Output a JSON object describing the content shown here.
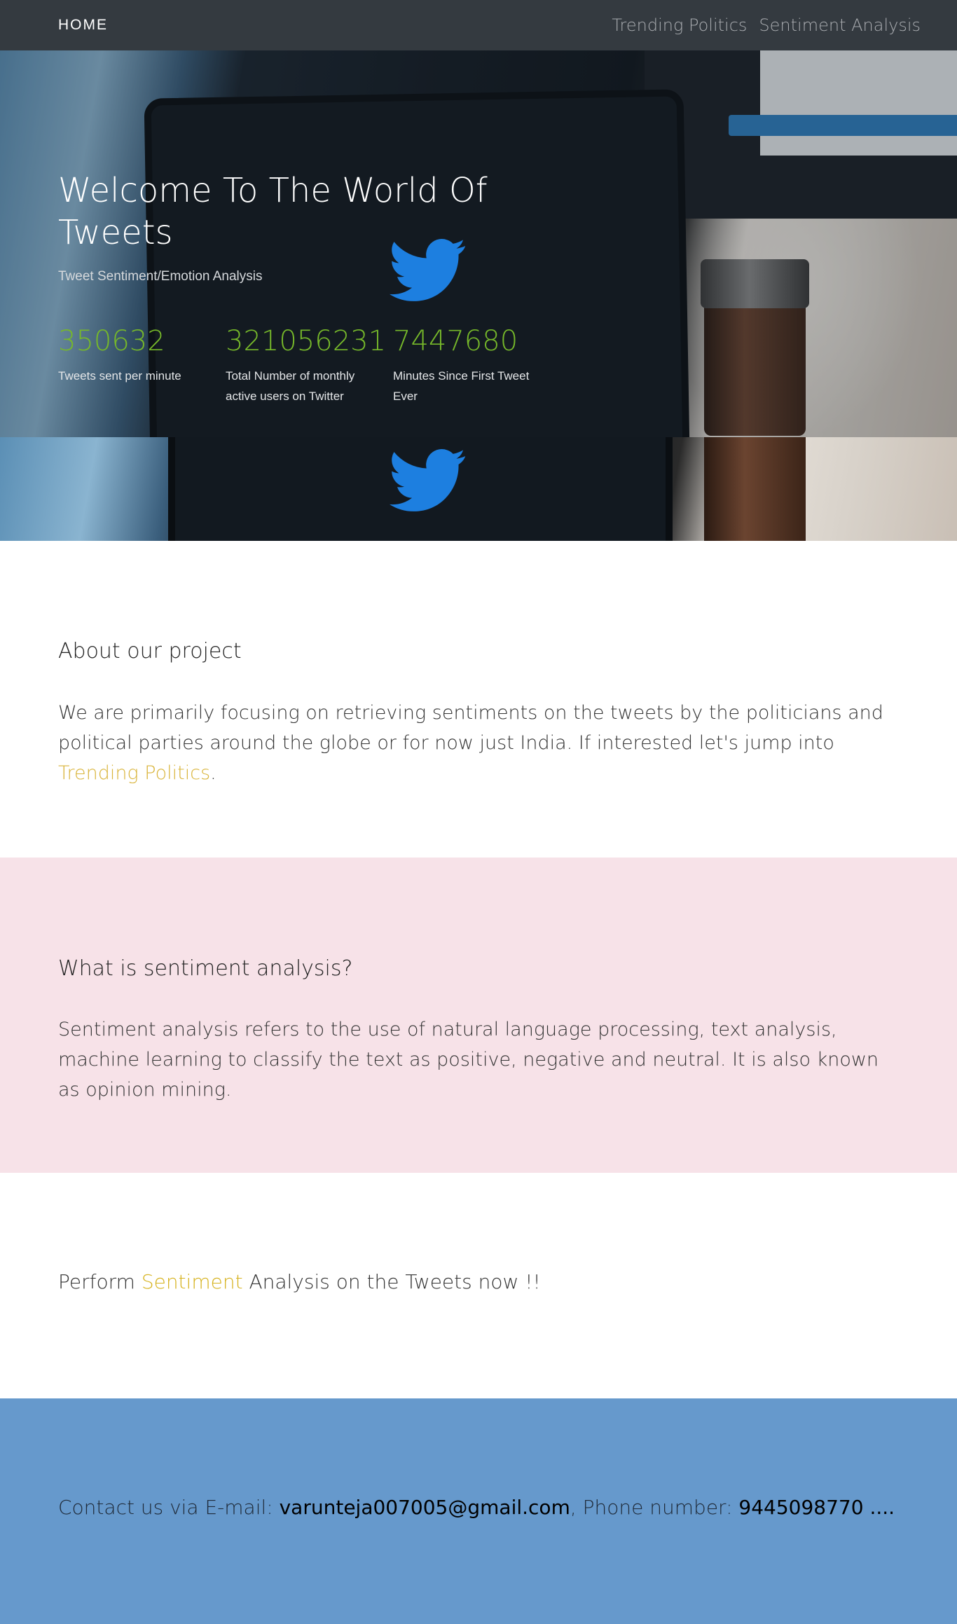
{
  "navbar": {
    "brand": "HOME",
    "links": [
      {
        "label": "Trending Politics"
      },
      {
        "label": "Sentiment Analysis"
      }
    ]
  },
  "hero": {
    "title": "Welcome To The World Of Tweets",
    "subtitle": "Tweet Sentiment/Emotion Analysis",
    "stats": [
      {
        "number": "350632",
        "label": "Tweets sent per minute"
      },
      {
        "number": "321056231",
        "label": "Total Number of monthly active users on Twitter"
      },
      {
        "number": "7447680",
        "label": "Minutes Since First Tweet Ever"
      }
    ],
    "icon": "twitter-bird-icon"
  },
  "about": {
    "heading": "About our project",
    "text_before": "We are primarily focusing on retrieving sentiments on the tweets by the politicians and political parties around the globe or for now just India. If interested let's jump into ",
    "link": "Trending Politics",
    "text_after": "."
  },
  "sentiment": {
    "heading": "What is sentiment analysis?",
    "text": "Sentiment analysis refers to the use of natural language processing, text analysis, machine learning to classify the text as positive, negative and neutral. It is also known as opinion mining."
  },
  "perform": {
    "text_before": "Perform ",
    "link": "Sentiment",
    "text_after": " Analysis on the Tweets now !!"
  },
  "contact": {
    "prefix": "Contact us via E-mail: ",
    "email": "varunteja007005@gmail.com",
    "middle": ", Phone number: ",
    "phone": "9445098770 ...."
  },
  "colors": {
    "navbar": "#343a40",
    "stat_number": "#76b82a",
    "link_gold": "#d6b21d",
    "sentiment_bg": "#f7e2e8",
    "contact_bg": "#6699cc"
  }
}
